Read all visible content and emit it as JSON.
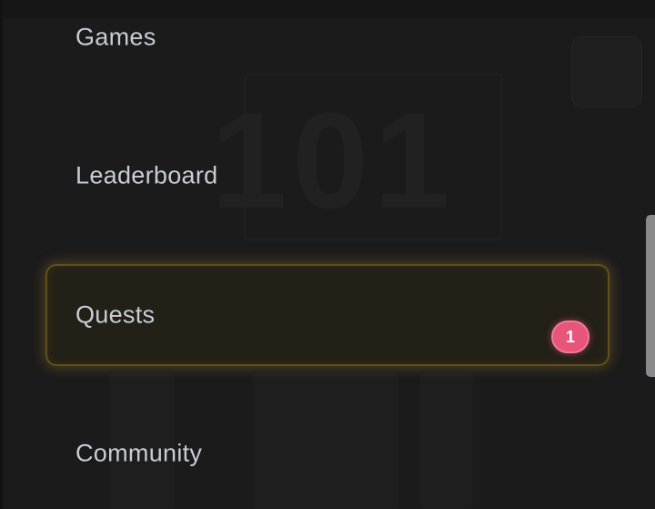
{
  "menu": {
    "items": [
      {
        "label": "Games"
      },
      {
        "label": "Leaderboard"
      },
      {
        "label": "Quests",
        "badge": "1"
      },
      {
        "label": "Community"
      }
    ]
  },
  "background": {
    "art_text": "101"
  },
  "colors": {
    "accent_glow": "#d6aa28",
    "badge": "#e8557b",
    "label": "#c9ccd6",
    "background": "#1b1b1c"
  }
}
